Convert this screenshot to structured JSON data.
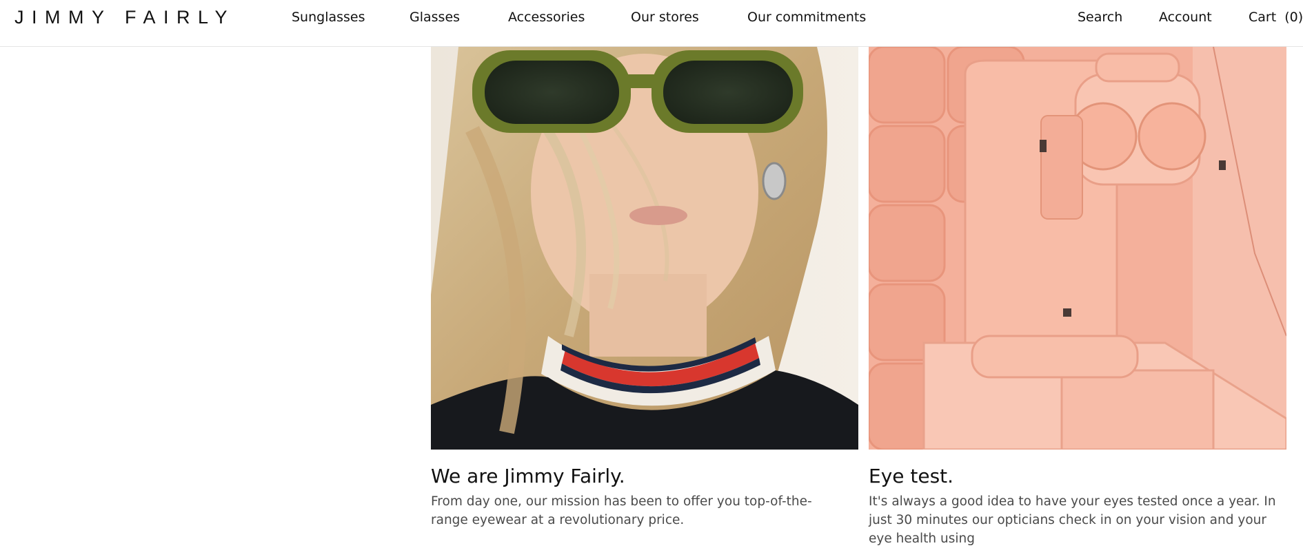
{
  "header": {
    "logo": "JIMMY FAIRLY",
    "nav": [
      {
        "label": "Sunglasses"
      },
      {
        "label": "Glasses"
      },
      {
        "label": "Accessories"
      },
      {
        "label": "Our stores"
      },
      {
        "label": "Our commitments"
      }
    ],
    "search_label": "Search",
    "account_label": "Account",
    "cart_label": "Cart",
    "cart_count": "(0)"
  },
  "cards": [
    {
      "title": "We are Jimmy Fairly.",
      "text": "From day one, our mission has been to offer you top-of-the-range eyewear at a revolutionary price."
    },
    {
      "title": "Eye test.",
      "text": "It's always a good idea to have your eyes tested once a year. In just 30 minutes our opticians check in on your vision and your eye health using"
    }
  ],
  "colors": {
    "brand_text": "#111111",
    "body_text": "#4a4a4a",
    "pink_backdrop": "#f2a891"
  }
}
